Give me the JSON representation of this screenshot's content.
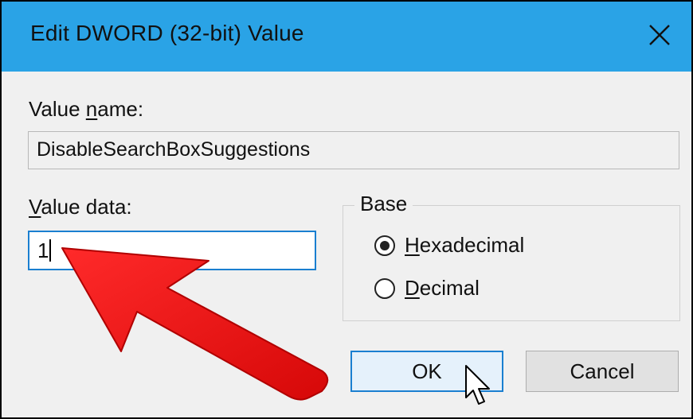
{
  "window": {
    "title": "Edit DWORD (32-bit) Value",
    "close_glyph": "✕",
    "accent_color": "#2aa3e6"
  },
  "value_name": {
    "label_underlined": "n",
    "label_pre": "Value ",
    "label_post": "ame:",
    "value": "DisableSearchBoxSuggestions"
  },
  "value_data": {
    "label_underlined": "V",
    "label_post": "alue data:",
    "value": "1"
  },
  "base": {
    "title": "Base",
    "options": [
      {
        "underlined": "H",
        "rest": "exadecimal",
        "selected": true
      },
      {
        "underlined": "D",
        "rest": "ecimal",
        "selected": false
      }
    ]
  },
  "buttons": {
    "ok_label": "OK",
    "cancel_label": "Cancel"
  },
  "annotation": {
    "arrow_color": "#e81010",
    "cursor_icon": "arrow-pointer"
  }
}
